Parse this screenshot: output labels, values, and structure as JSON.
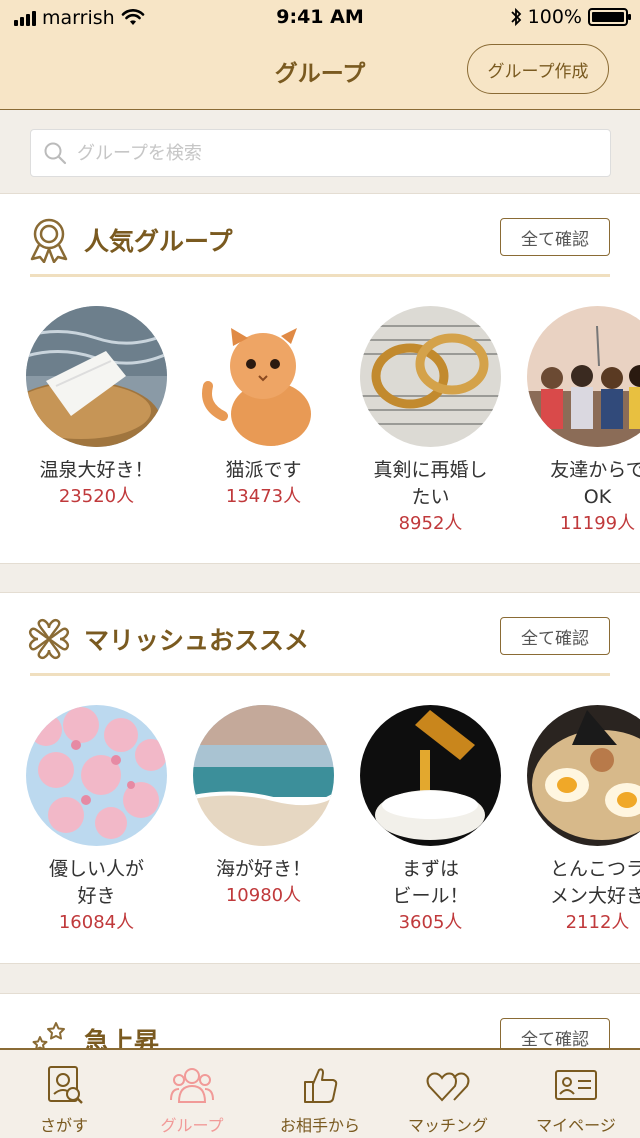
{
  "status": {
    "carrier": "marrish",
    "time": "9:41 AM",
    "battery": "100%"
  },
  "header": {
    "title": "グループ",
    "create_label": "グループ作成"
  },
  "search": {
    "placeholder": "グループを検索"
  },
  "sections": [
    {
      "icon": "ribbon-award-icon",
      "title": "人気グループ",
      "see_all": "全て確認",
      "groups": [
        {
          "name": "温泉大好き！",
          "count": "23520人",
          "image": "towel-hot-spring"
        },
        {
          "name": "猫派です",
          "count": "13473人",
          "image": "kitten"
        },
        {
          "name": "真剣に再婚し\nたい",
          "count": "8952人",
          "image": "wedding-rings"
        },
        {
          "name": "友達からで\nOK",
          "count": "11199人",
          "image": "friends-group"
        }
      ]
    },
    {
      "icon": "clover-icon",
      "title": "マリッシュおススメ",
      "see_all": "全て確認",
      "groups": [
        {
          "name": "優しい人が\n好き",
          "count": "16084人",
          "image": "cherry-blossoms"
        },
        {
          "name": "海が好き！",
          "count": "10980人",
          "image": "ocean-beach"
        },
        {
          "name": "まずは\nビール！",
          "count": "3605人",
          "image": "beer-pour"
        },
        {
          "name": "とんこつラ\nメン大好き",
          "count": "2112人",
          "image": "ramen"
        }
      ]
    },
    {
      "icon": "stars-icon",
      "title": "急上昇",
      "see_all": "全て確認"
    }
  ],
  "tabs": [
    {
      "label": "さがす",
      "icon": "search-profile-icon",
      "active": false
    },
    {
      "label": "グループ",
      "icon": "group-icon",
      "active": true
    },
    {
      "label": "お相手から",
      "icon": "thumbs-up-icon",
      "active": false
    },
    {
      "label": "マッチング",
      "icon": "hearts-icon",
      "active": false
    },
    {
      "label": "マイページ",
      "icon": "id-card-icon",
      "active": false
    }
  ],
  "colors": {
    "header_bg": "#f7e5c6",
    "brand_brown": "#7a5a20",
    "count_red": "#c0393b",
    "active_tab": "#f19a98"
  }
}
